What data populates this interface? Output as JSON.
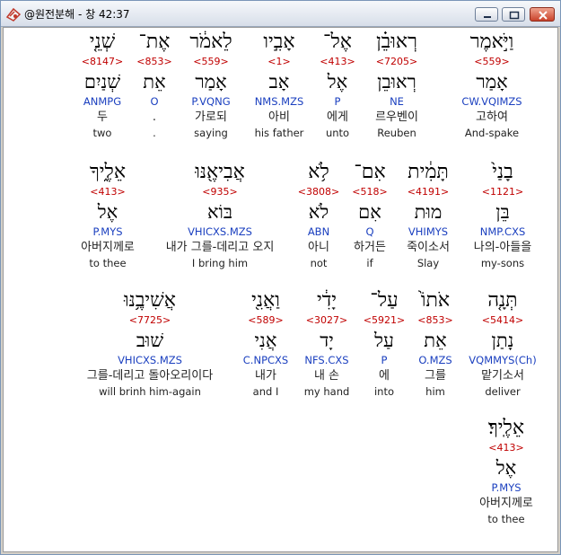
{
  "window": {
    "title": "@원전분해 - 창 42:37"
  },
  "rows": [
    {
      "words": [
        {
          "heb": "וַיֹּ֣אמֶר",
          "strong": "<559>",
          "lemma": "אָמַר",
          "morph": "CW.VQIMZS",
          "kor": "고하여",
          "eng": "And-spake",
          "highlight": true
        },
        {
          "heb": "רְאוּבֵ֗ן",
          "strong": "<7205>",
          "lemma": "רְאוּבֵן",
          "morph": "NE",
          "kor": "르우벤이",
          "eng": "Reuben"
        },
        {
          "heb": "אֶל־",
          "strong": "<413>",
          "lemma": "אֶל",
          "morph": "P",
          "kor": "에게",
          "eng": "unto"
        },
        {
          "heb": "אָבִ֣יו",
          "strong": "<1>",
          "lemma": "אָב",
          "morph": "NMS.MZS",
          "kor": "아비",
          "eng": "his father"
        },
        {
          "heb": "לֵאמֹ֔ר",
          "strong": "<559>",
          "lemma": "אָמַר",
          "morph": "P.VQNG",
          "kor": "가로되",
          "eng": "saying"
        },
        {
          "heb": "אֶת־",
          "strong": "<853>",
          "lemma": "אֵת",
          "morph": "O",
          "kor": ".",
          "eng": "."
        },
        {
          "heb": "שְׁנֵ֤י",
          "strong": "<8147>",
          "lemma": "שְׁנַיִם",
          "morph": "ANMPG",
          "kor": "두",
          "eng": "two"
        }
      ]
    },
    {
      "words": [
        {
          "heb": "בָנַי֙",
          "strong": "<1121>",
          "lemma": "בֵּן",
          "morph": "NMP.CXS",
          "kor": "나의-아들을",
          "eng": "my-sons"
        },
        {
          "heb": "תָּמִ֔ית",
          "strong": "<4191>",
          "lemma": "מוּת",
          "morph": "VHIMYS",
          "kor": "죽이소서",
          "eng": "Slay"
        },
        {
          "heb": "אִם־",
          "strong": "<518>",
          "lemma": "אִם",
          "morph": "Q",
          "kor": "하거든",
          "eng": "if"
        },
        {
          "heb": "לֹ֥א",
          "strong": "<3808>",
          "lemma": "לֹא",
          "morph": "ABN",
          "kor": "아니",
          "eng": "not"
        },
        {
          "heb": "אֲבִיאֶ֖נּוּ",
          "strong": "<935>",
          "lemma": "בּוֹא",
          "morph": "VHICXS.MZS",
          "kor": "내가 그를-데리고 오지",
          "eng": "I bring him"
        },
        {
          "heb": "אֵלֶ֑יךָ",
          "strong": "<413>",
          "lemma": "אֶל",
          "morph": "P.MYS",
          "kor": "아버지께로",
          "eng": "to thee"
        }
      ]
    },
    {
      "words": [
        {
          "heb": "תְּנָ֤ה",
          "strong": "<5414>",
          "lemma": "נָתַן",
          "morph": "VQMMYS(Ch)",
          "kor": "맡기소서",
          "eng": "deliver"
        },
        {
          "heb": "אֹתוֹ֙",
          "strong": "<853>",
          "lemma": "אֵת",
          "morph": "O.MZS",
          "kor": "그를",
          "eng": "him"
        },
        {
          "heb": "עַל־",
          "strong": "<5921>",
          "lemma": "עַל",
          "morph": "P",
          "kor": "에",
          "eng": "into"
        },
        {
          "heb": "יָדִ֔י",
          "strong": "<3027>",
          "lemma": "יָד",
          "morph": "NFS.CXS",
          "kor": "내 손",
          "eng": "my hand"
        },
        {
          "heb": "וַאֲנִ֖י",
          "strong": "<589>",
          "lemma": "אֲנִי",
          "morph": "C.NPCXS",
          "kor": "내가",
          "eng": "and I"
        },
        {
          "heb": "אֲשִׁיבֶ֥נּוּ",
          "strong": "<7725>",
          "lemma": "שׁוּב",
          "morph": "VHICXS.MZS",
          "kor": "그를-데리고 돌아오리이다",
          "eng": "will brinh him-again"
        }
      ]
    },
    {
      "words": [
        {
          "heb": "אֵלֶֽיךָ׃",
          "strong": "<413>",
          "lemma": "אֶל",
          "morph": "P.MYS",
          "kor": "아버지께로",
          "eng": "to thee"
        }
      ]
    }
  ]
}
